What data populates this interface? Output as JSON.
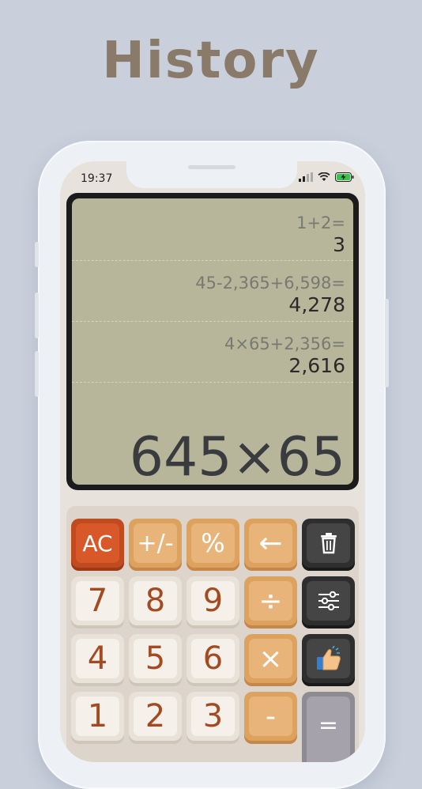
{
  "headline": "History",
  "status_bar": {
    "time": "19:37"
  },
  "history": [
    {
      "expr": "1+2=",
      "result": "3"
    },
    {
      "expr": "45-2,365+6,598=",
      "result": "4,278"
    },
    {
      "expr": "4×65+2,356=",
      "result": "2,616"
    }
  ],
  "display": {
    "current": "645×65"
  },
  "keys": {
    "ac": "AC",
    "plus_minus": "+/-",
    "percent": "%",
    "backspace": "←",
    "seven": "7",
    "eight": "8",
    "nine": "9",
    "divide": "÷",
    "four": "4",
    "five": "5",
    "six": "6",
    "multiply": "×",
    "one": "1",
    "two": "2",
    "three": "3",
    "minus": "-",
    "equals": "="
  },
  "icons": {
    "delete": "trash-icon",
    "settings": "sliders-icon",
    "rate": "thumbs-up-icon"
  },
  "colors": {
    "background": "#c9d0dc",
    "headline": "#8a7a69",
    "lcd": "#b7b69b",
    "ac_key": "#d8582a",
    "operator_key": "#e9b47a",
    "number_text": "#a34a22"
  }
}
